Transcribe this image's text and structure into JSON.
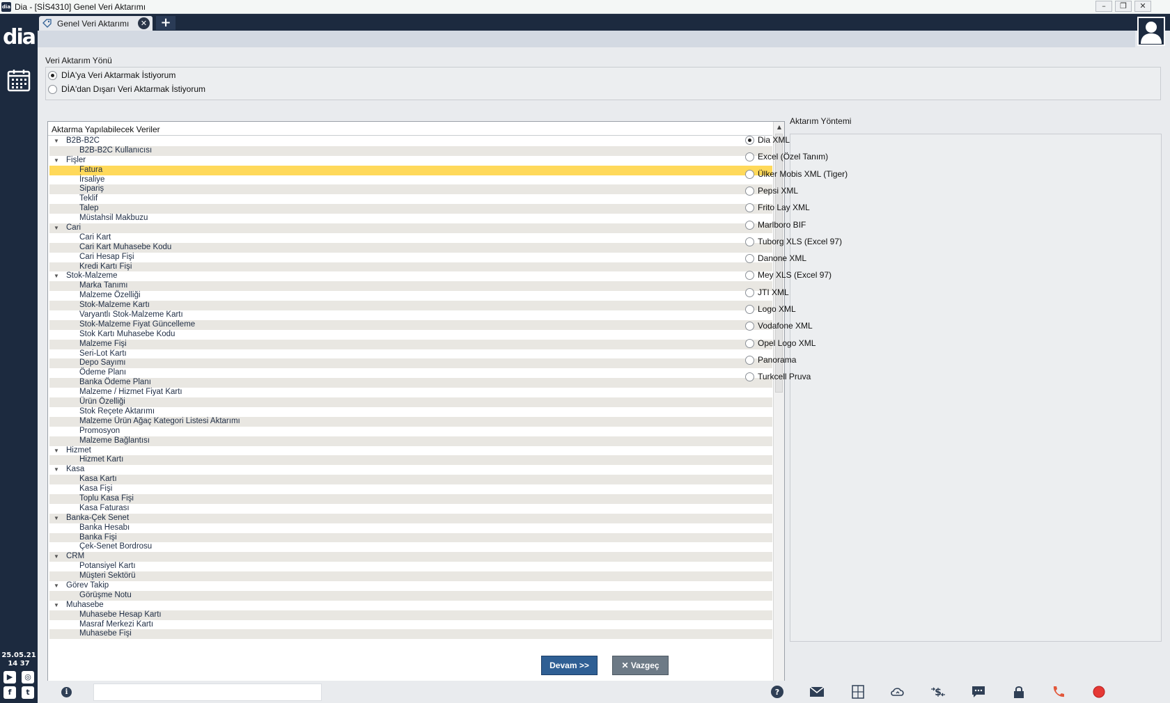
{
  "window": {
    "title": "Dia - [SİS4310] Genel Veri Aktarımı",
    "app_icon": "dia",
    "controls": [
      "minimize-icon",
      "restore-icon",
      "close-icon"
    ]
  },
  "sidebar": {
    "logo": "dia",
    "calendar_icon": "calendar-icon",
    "date": "25.05.21",
    "time": "14 37",
    "social": [
      "youtube-icon",
      "instagram-icon",
      "facebook-icon",
      "twitter-icon"
    ]
  },
  "tabs": {
    "active_label": "Genel Veri Aktarımı",
    "add_label": "+"
  },
  "direction": {
    "legend": "Veri Aktarım Yönü",
    "options": [
      {
        "label": "DİA'ya Veri Aktarmak İstiyorum",
        "selected": true
      },
      {
        "label": "DİA'dan Dışarı Veri Aktarmak İstiyorum",
        "selected": false
      }
    ]
  },
  "tree": {
    "header": "Aktarma Yapılabilecek Veriler",
    "rows": [
      {
        "label": "B2B-B2C",
        "level": 0
      },
      {
        "label": "B2B-B2C Kullanıcısı",
        "level": 1
      },
      {
        "label": "Fişler",
        "level": 0
      },
      {
        "label": "Fatura",
        "level": 1,
        "selected": true
      },
      {
        "label": "İrsaliye",
        "level": 1
      },
      {
        "label": "Sipariş",
        "level": 1
      },
      {
        "label": "Teklif",
        "level": 1
      },
      {
        "label": "Talep",
        "level": 1
      },
      {
        "label": "Müstahsil Makbuzu",
        "level": 1
      },
      {
        "label": "Cari",
        "level": 0
      },
      {
        "label": "Cari Kart",
        "level": 1
      },
      {
        "label": "Cari Kart Muhasebe Kodu",
        "level": 1
      },
      {
        "label": "Cari Hesap Fişi",
        "level": 1
      },
      {
        "label": "Kredi Kartı Fişi",
        "level": 1
      },
      {
        "label": "Stok-Malzeme",
        "level": 0
      },
      {
        "label": "Marka Tanımı",
        "level": 1
      },
      {
        "label": "Malzeme Özelliği",
        "level": 1
      },
      {
        "label": "Stok-Malzeme Kartı",
        "level": 1
      },
      {
        "label": "Varyantlı Stok-Malzeme Kartı",
        "level": 1
      },
      {
        "label": "Stok-Malzeme Fiyat Güncelleme",
        "level": 1
      },
      {
        "label": "Stok Kartı Muhasebe Kodu",
        "level": 1
      },
      {
        "label": "Malzeme Fişi",
        "level": 1
      },
      {
        "label": "Seri-Lot Kartı",
        "level": 1
      },
      {
        "label": "Depo Sayımı",
        "level": 1
      },
      {
        "label": "Ödeme Planı",
        "level": 1
      },
      {
        "label": "Banka Ödeme Planı",
        "level": 1
      },
      {
        "label": "Malzeme / Hizmet Fiyat Kartı",
        "level": 1
      },
      {
        "label": "Ürün Özelliği",
        "level": 1
      },
      {
        "label": "Stok Reçete Aktarımı",
        "level": 1
      },
      {
        "label": "Malzeme Ürün Ağaç Kategori Listesi Aktarımı",
        "level": 1
      },
      {
        "label": "Promosyon",
        "level": 1
      },
      {
        "label": "Malzeme Bağlantısı",
        "level": 1
      },
      {
        "label": "Hizmet",
        "level": 0
      },
      {
        "label": "Hizmet Kartı",
        "level": 1
      },
      {
        "label": "Kasa",
        "level": 0
      },
      {
        "label": "Kasa Kartı",
        "level": 1
      },
      {
        "label": "Kasa Fişi",
        "level": 1
      },
      {
        "label": "Toplu Kasa Fişi",
        "level": 1
      },
      {
        "label": "Kasa Faturası",
        "level": 1
      },
      {
        "label": "Banka-Çek Senet",
        "level": 0
      },
      {
        "label": "Banka Hesabı",
        "level": 1
      },
      {
        "label": "Banka Fişi",
        "level": 1
      },
      {
        "label": "Çek-Senet Bordrosu",
        "level": 1
      },
      {
        "label": "CRM",
        "level": 0
      },
      {
        "label": "Potansiyel Kartı",
        "level": 1
      },
      {
        "label": "Müşteri Sektörü",
        "level": 1
      },
      {
        "label": "Görev Takip",
        "level": 0
      },
      {
        "label": "Görüşme Notu",
        "level": 1
      },
      {
        "label": "Muhasebe",
        "level": 0
      },
      {
        "label": "Muhasebe Hesap Kartı",
        "level": 1
      },
      {
        "label": "Masraf Merkezi Kartı",
        "level": 1
      },
      {
        "label": "Muhasebe Fişi",
        "level": 1
      }
    ]
  },
  "method": {
    "legend": "Aktarım Yöntemi",
    "options": [
      {
        "label": "Dia XML",
        "selected": true
      },
      {
        "label": "Excel (Özel Tanım)",
        "selected": false
      },
      {
        "label": "Ülker Mobis XML (Tiger)",
        "selected": false
      },
      {
        "label": "Pepsi XML",
        "selected": false
      },
      {
        "label": "Frito Lay XML",
        "selected": false
      },
      {
        "label": "Marlboro BIF",
        "selected": false
      },
      {
        "label": "Tuborg XLS (Excel 97)",
        "selected": false
      },
      {
        "label": "Danone XML",
        "selected": false
      },
      {
        "label": "Mey XLS (Excel 97)",
        "selected": false
      },
      {
        "label": "JTI XML",
        "selected": false
      },
      {
        "label": "Logo XML",
        "selected": false
      },
      {
        "label": "Vodafone XML",
        "selected": false
      },
      {
        "label": "Opel Logo XML",
        "selected": false
      },
      {
        "label": "Panorama",
        "selected": false
      },
      {
        "label": "Turkcell Pruva",
        "selected": false
      }
    ]
  },
  "buttons": {
    "continue": "Devam >>",
    "cancel": "Vazgeç"
  },
  "bottombar": {
    "icons": [
      "help-icon",
      "mail-icon",
      "calculator-icon",
      "cloud-sync-icon",
      "currency-exchange-icon",
      "chat-icon",
      "lock-icon",
      "phone-icon",
      "record-icon"
    ],
    "colors": {
      "phone": "#e2573a",
      "record": "#e53935"
    }
  },
  "colors": {
    "nav": "#1c2a3f",
    "selected_row": "#ffd95a",
    "primary_button": "#2f5f94"
  }
}
